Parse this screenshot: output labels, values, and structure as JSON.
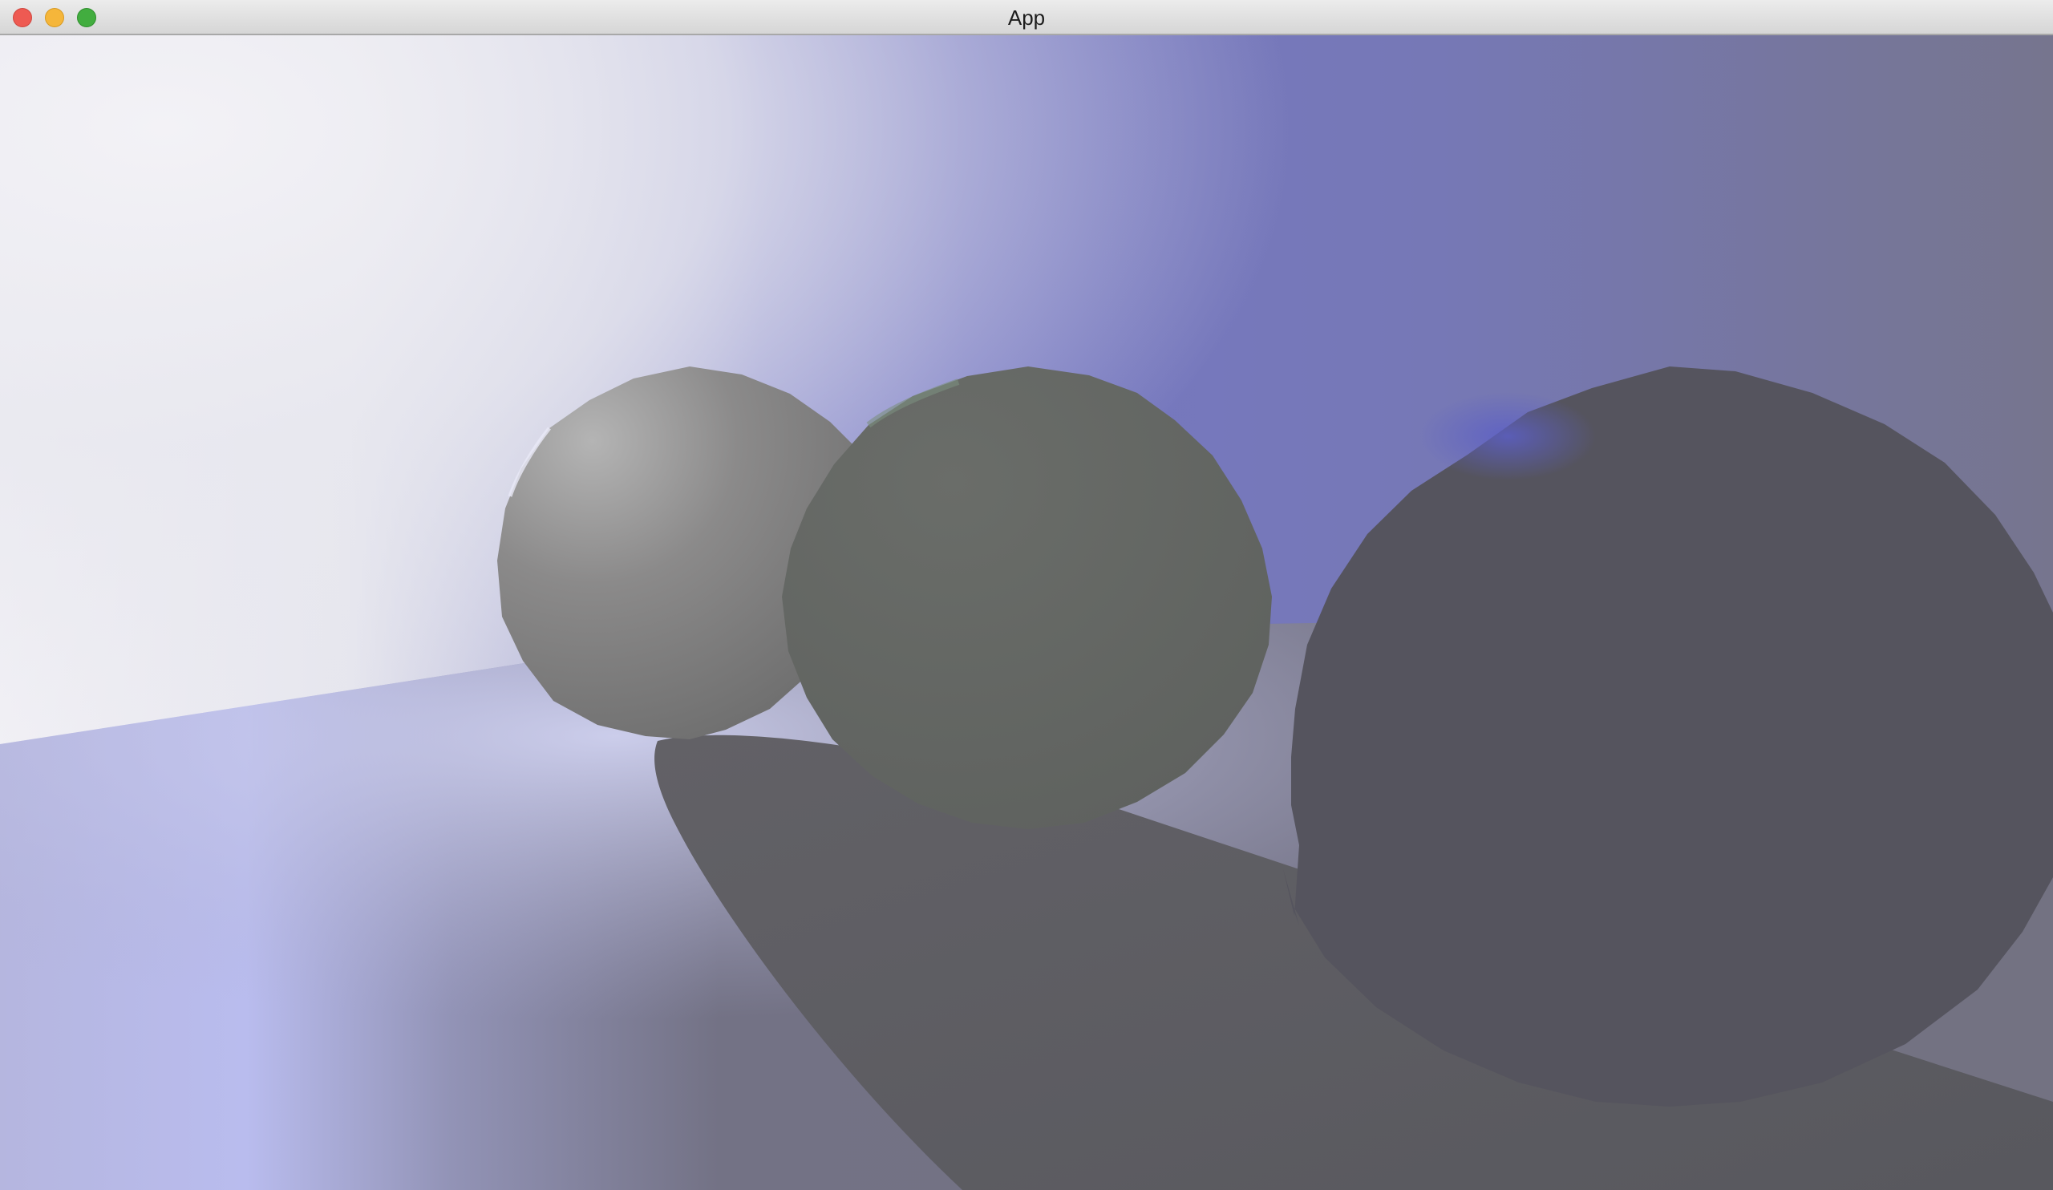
{
  "window": {
    "title": "App",
    "controls": {
      "close": "close-button",
      "minimize": "minimize-button",
      "zoom": "zoom-button"
    }
  },
  "scene": {
    "description_colors": {
      "sky_left": "#f1f0f5",
      "sky_mid": "#7b7dc7",
      "sky_right": "#76758e",
      "floor": "#737285",
      "sphere_small": "#8b8a8a",
      "sphere_middle": "#636662",
      "sphere_large": "#55545e",
      "shadow": "#5c5c61"
    }
  }
}
